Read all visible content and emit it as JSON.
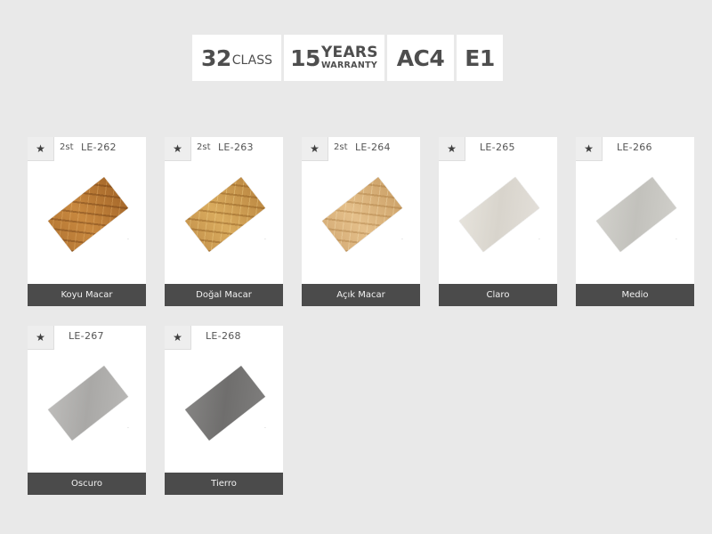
{
  "badges": {
    "class": {
      "number": "32",
      "text": "CLASS"
    },
    "warranty": {
      "number": "15",
      "top": "YEARS",
      "bottom": "WARRANTY"
    },
    "ac": {
      "text": "AC4"
    },
    "e": {
      "text": "E1"
    }
  },
  "fav_icon": "star-icon",
  "products": [
    {
      "count": "2st",
      "code": "LE-262",
      "name": "Koyu Macar"
    },
    {
      "count": "2st",
      "code": "LE-263",
      "name": "Doğal Macar"
    },
    {
      "count": "2st",
      "code": "LE-264",
      "name": "Açık Macar"
    },
    {
      "count": "",
      "code": "LE-265",
      "name": "Claro"
    },
    {
      "count": "",
      "code": "LE-266",
      "name": "Medio"
    },
    {
      "count": "",
      "code": "LE-267",
      "name": "Oscuro"
    },
    {
      "count": "",
      "code": "LE-268",
      "name": "Tierro"
    }
  ],
  "colors": {
    "background": "#e9e9e9",
    "label_bar": "#4b4b4b"
  }
}
